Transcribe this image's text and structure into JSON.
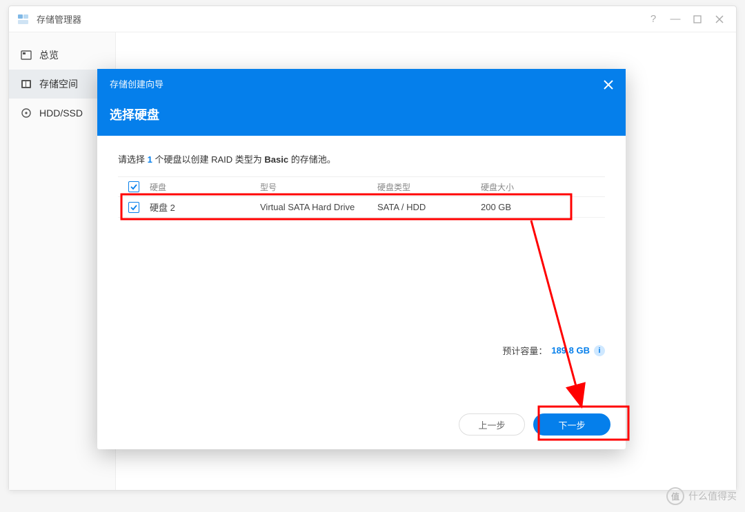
{
  "window": {
    "title": "存储管理器"
  },
  "sidebar": {
    "items": [
      {
        "label": "总览"
      },
      {
        "label": "存储空间"
      },
      {
        "label": "HDD/SSD"
      }
    ]
  },
  "dialog": {
    "title_small": "存储创建向导",
    "title_big": "选择硬盘",
    "instruction_prefix": "请选择 ",
    "instruction_count": "1",
    "instruction_mid": " 个硬盘以创建 RAID 类型为 ",
    "instruction_basic": "Basic",
    "instruction_suffix": " 的存储池。",
    "table": {
      "headers": {
        "disk": "硬盘",
        "model": "型号",
        "type": "硬盘类型",
        "size": "硬盘大小"
      },
      "rows": [
        {
          "disk": "硬盘 2",
          "model": "Virtual SATA Hard Drive",
          "type": "SATA / HDD",
          "size": "200 GB",
          "checked": true
        }
      ]
    },
    "summary": {
      "label": "预计容量：",
      "value": "189.8 GB"
    },
    "buttons": {
      "prev": "上一步",
      "next": "下一步"
    }
  },
  "watermark": {
    "badge": "值",
    "text": "什么值得买"
  }
}
